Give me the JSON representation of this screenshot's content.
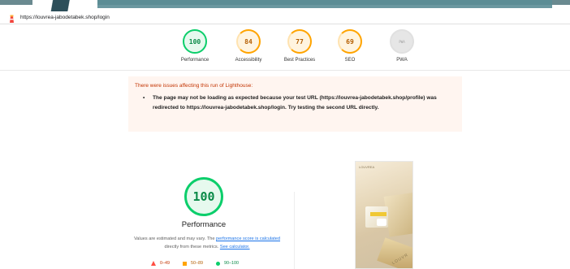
{
  "browser": {
    "url": "https://louvrea-jabodetabek.shop/login",
    "logo_icon": "lighthouse-icon"
  },
  "gauges": [
    {
      "label": "Performance",
      "score": "100",
      "status": "pass"
    },
    {
      "label": "Accessibility",
      "score": "84",
      "status": "average"
    },
    {
      "label": "Best Practices",
      "score": "77",
      "status": "average"
    },
    {
      "label": "SEO",
      "score": "69",
      "status": "average"
    },
    {
      "label": "PWA",
      "score": "PWA",
      "status": "na"
    }
  ],
  "warning": {
    "title": "There were issues affecting this run of Lighthouse:",
    "items": [
      "The page may not be loading as expected because your test URL (https://louvrea-jabodetabek.shop/profile) was redirected to https://louvrea-jabodetabek.shop/login. Try testing the second URL directly."
    ]
  },
  "performance": {
    "score": "100",
    "label": "Performance",
    "desc_pre": "Values are estimated and may vary. The ",
    "desc_link1": "performance score is calculated",
    "desc_mid": " directly from these metrics. ",
    "desc_link2": "See calculator.",
    "legend": [
      {
        "range": "0–49",
        "color": "#ff4e42",
        "shape": "triangle"
      },
      {
        "range": "50–89",
        "color": "#ffa400",
        "shape": "square"
      },
      {
        "range": "90–100",
        "color": "#0cce6b",
        "shape": "circle"
      }
    ]
  },
  "thumbnail": {
    "caption_top": "LOUVREA",
    "product_text": "LOUVR"
  },
  "colors": {
    "pass": "#0cce6b",
    "average": "#ffa400",
    "fail": "#ff4e42",
    "warning_bg": "#fff5f0",
    "warning_text": "#c33300"
  }
}
